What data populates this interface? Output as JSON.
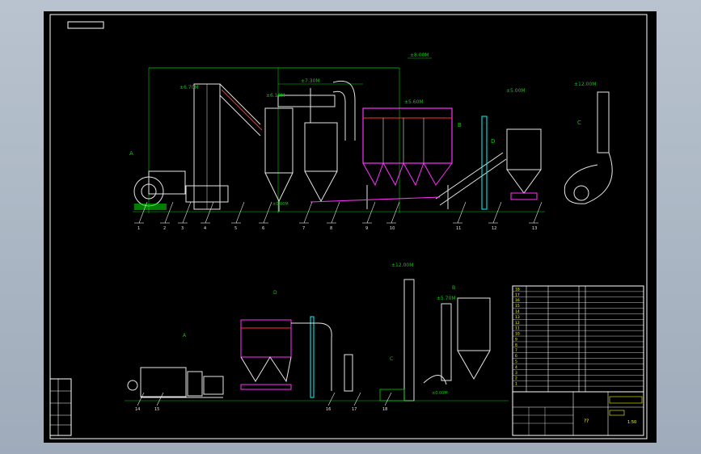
{
  "viewer": {
    "background": "#a8b4c2",
    "sheet_color": "#000000"
  },
  "colors": {
    "frame": "#ffffff",
    "equipment": "#e6e6e6",
    "dimension": "#00d000",
    "duct_red": "#ff3030",
    "magenta": "#ff30ff",
    "yellow": "#ffff00",
    "cyan": "#00ffff",
    "blue": "#4060ff"
  },
  "upper_view": {
    "top_elevation": "±8.00M",
    "elevations": [
      "±6.70M",
      "±6.10M",
      "±7.30M",
      "±5.60M",
      "±5.00M",
      "±12.00M"
    ],
    "zero_level": "±0.00M",
    "section_labels": [
      "A",
      "B",
      "C",
      "D"
    ],
    "part_numbers": [
      "1",
      "2",
      "3",
      "4",
      "5",
      "6",
      "7",
      "8",
      "9",
      "10",
      "11",
      "12",
      "13"
    ]
  },
  "lower_view": {
    "elevations": [
      "±12.00M",
      "±5.70M",
      "±0.00M"
    ],
    "section_labels": [
      "A",
      "C",
      "D",
      "B"
    ],
    "part_numbers": [
      "14",
      "15",
      "16",
      "17",
      "18"
    ]
  },
  "parts_table": {
    "row_numbers": [
      "18",
      "17",
      "16",
      "15",
      "14",
      "13",
      "12",
      "11",
      "10",
      "9",
      "8",
      "7",
      "6",
      "5",
      "4",
      "3",
      "2",
      "1"
    ],
    "codes": [
      "",
      "",
      "",
      "",
      "",
      "",
      "",
      "",
      "",
      "",
      "",
      "",
      "",
      "",
      "",
      "",
      "",
      ""
    ]
  },
  "title_block": {
    "caption": "??",
    "scale": "1:50"
  }
}
